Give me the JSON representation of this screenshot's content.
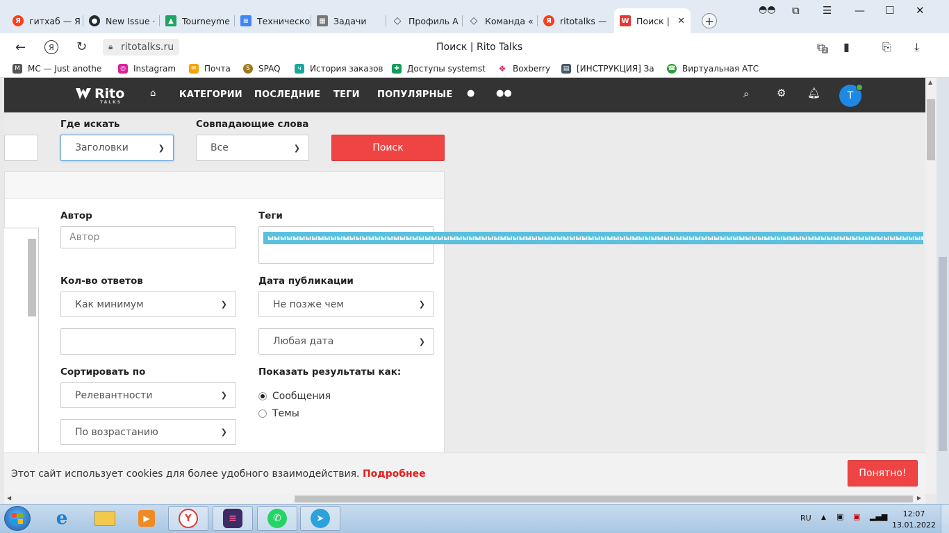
{
  "browser": {
    "tabs": [
      {
        "label": "гитхаб — Я",
        "icon": "yandex-icon",
        "color": "#fc3f1d"
      },
      {
        "label": "New Issue ·",
        "icon": "github-icon",
        "color": "#24292e"
      },
      {
        "label": "Tourneyme",
        "icon": "google-drive-icon",
        "color": "#1fa463"
      },
      {
        "label": "Техническо",
        "icon": "google-docs-icon",
        "color": "#4285f4"
      },
      {
        "label": "Задачи",
        "icon": "tasks-icon",
        "color": "#666666"
      },
      {
        "label": "Профиль А",
        "icon": "diamond-icon",
        "color": "#555555"
      },
      {
        "label": "Команда «",
        "icon": "diamond-icon",
        "color": "#555555"
      },
      {
        "label": "ritotalks —",
        "icon": "yandex-icon",
        "color": "#fc3f1d"
      },
      {
        "label": "Поиск |",
        "icon": "ritotalks-icon",
        "color": "#e53935",
        "active": true
      }
    ],
    "url": "ritotalks.ru",
    "page_title": "Поиск | Rito Talks",
    "bookmarks": [
      {
        "label": "MC — Just anothe",
        "icon": "mc-icon",
        "color": "#444444"
      },
      {
        "label": "Instagram",
        "icon": "instagram-icon",
        "color": "#d6249f"
      },
      {
        "label": "Почта",
        "icon": "mail-icon",
        "color": "#f4a300"
      },
      {
        "label": "SPAQ",
        "icon": "spaq-icon",
        "color": "#9c7a1d"
      },
      {
        "label": "История заказов",
        "icon": "orders-icon",
        "color": "#19a89d"
      },
      {
        "label": "Доступы systemstu",
        "icon": "sheets-icon",
        "color": "#0f9d58"
      },
      {
        "label": "Boxberry",
        "icon": "boxberry-icon",
        "color": "#d81b60"
      },
      {
        "label": "[ИНСТРУКЦИЯ] За",
        "icon": "printer-icon",
        "color": "#455a64"
      },
      {
        "label": "Виртуальная АТС М",
        "icon": "phone-icon",
        "color": "#2e9d3a"
      }
    ],
    "tab_count_badge": "2"
  },
  "site": {
    "logo_text": "Rito",
    "logo_sub": "TALKS",
    "nav": {
      "categories": "КАТЕГОРИИ",
      "recent": "ПОСЛЕДНИЕ",
      "tags": "ТЕГИ",
      "popular": "ПОПУЛЯРНЫЕ"
    },
    "avatar_letter": "T",
    "accent": "#ef4444",
    "header_bg": "#333333"
  },
  "search": {
    "where_label": "Где искать",
    "where_value": "Заголовки",
    "match_label": "Совпадающие слова",
    "match_value": "Все",
    "submit_label": "Поиск"
  },
  "filters": {
    "author_label": "Автор",
    "author_placeholder": "Автор",
    "tags_label": "Теги",
    "tag_value": "ыыыыыыыыыыыыыыыыыыыыыыыыыыыыыыыыыыыыыыыыыыыыыыыыыыыыыыыыыыыыыыыыыыыыыыыыыыыыыыыыыыыыыыыыыыыыыыыыыыыыыыыыыыыыыыыыыыыыыыыыыыыыы",
    "replies_label": "Кол-во ответов",
    "replies_value": "Как минимум",
    "date_label": "Дата публикации",
    "date_mode_value": "Не позже чем",
    "date_value": "Любая дата",
    "sort_label": "Сортировать по",
    "sort_value": "Релевантности",
    "order_value": "По возрастанию",
    "show_label": "Показать результаты как:",
    "show_options": [
      {
        "label": "Сообщения",
        "checked": true
      },
      {
        "label": "Темы",
        "checked": false
      }
    ]
  },
  "cookie": {
    "text": "Этот сайт использует cookies для более удобного взаимодействия.",
    "link": "Подробнее",
    "accept": "Понятно!"
  },
  "taskbar": {
    "lang": "RU",
    "time": "12:07",
    "date": "13.01.2022"
  }
}
